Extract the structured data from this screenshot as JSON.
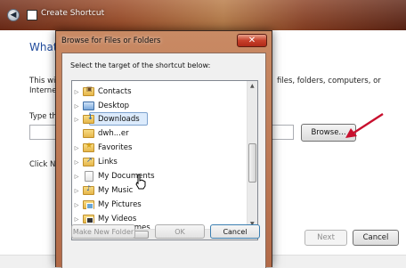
{
  "wizard": {
    "title": "Create Shortcut",
    "heading": "What",
    "description_left": "This wiz",
    "description_right": "files, folders, computers, or",
    "description_line2": "Internet",
    "type_label": "Type the",
    "browse_label": "Browse...",
    "click_text": "Click Ne",
    "next_label": "Next",
    "cancel_label": "Cancel"
  },
  "dialog": {
    "title": "Browse for Files or Folders",
    "prompt": "Select the target of the shortcut below:",
    "items": [
      {
        "label": "Contacts",
        "icon": "contacts-folder-icon",
        "expandable": true
      },
      {
        "label": "Desktop",
        "icon": "desktop-folder-icon",
        "expandable": true
      },
      {
        "label": "Downloads",
        "icon": "downloads-folder-icon",
        "expandable": true,
        "selected": true
      },
      {
        "label": "dwh...er",
        "icon": "folder-icon",
        "expandable": false
      },
      {
        "label": "Favorites",
        "icon": "favorites-folder-icon",
        "expandable": true
      },
      {
        "label": "Links",
        "icon": "links-folder-icon",
        "expandable": true
      },
      {
        "label": "My Documents",
        "icon": "documents-folder-icon",
        "expandable": true
      },
      {
        "label": "My Music",
        "icon": "music-folder-icon",
        "expandable": true
      },
      {
        "label": "My Pictures",
        "icon": "pictures-folder-icon",
        "expandable": true
      },
      {
        "label": "My Videos",
        "icon": "videos-folder-icon",
        "expandable": true
      },
      {
        "label": "Saved Games",
        "icon": "games-folder-icon",
        "expandable": true
      }
    ],
    "make_new_folder_label": "Make New Folder",
    "ok_label": "OK",
    "cancel_label": "Cancel"
  }
}
